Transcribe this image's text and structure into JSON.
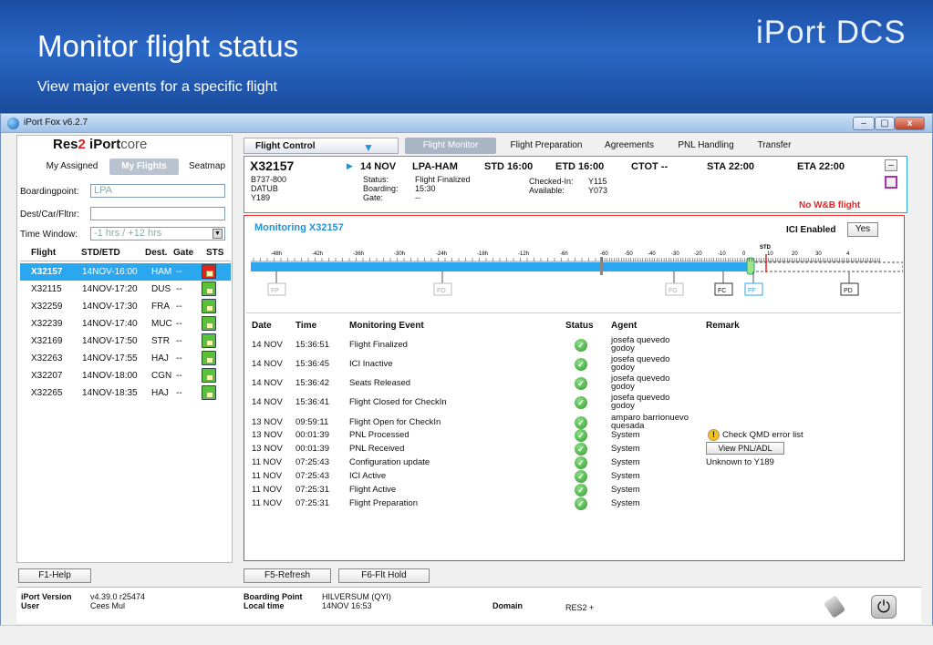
{
  "slide": {
    "title": "Monitor flight status",
    "subtitle": "View major events for a specific flight",
    "brand": "iPort DCS"
  },
  "window": {
    "title": "iPort Fox v6.2.7",
    "controls": {
      "min": "–",
      "max": "▢",
      "close": "x"
    }
  },
  "logo": {
    "part1": "Res",
    "part2": "2",
    "part3": " iPort",
    "part4": "core"
  },
  "left_tabs": [
    "My Assigned",
    "My Flights",
    "Seatmap"
  ],
  "filters": {
    "boardingpoint_label": "Boardingpoint:",
    "boardingpoint_value": "LPA",
    "destcar_label": "Dest/Car/Fltnr:",
    "destcar_value": "",
    "timewindow_label": "Time Window:",
    "timewindow_value": "-1 hrs / +12 hrs"
  },
  "flight_list": {
    "headers": {
      "flight": "Flight",
      "stdetd": "STD/ETD",
      "dest": "Dest.",
      "gate": "Gate",
      "sts": "STS"
    },
    "rows": [
      {
        "flight": "X32157",
        "time": "14NOV-16:00",
        "dest": "HAM",
        "gate": "--",
        "lock": "red"
      },
      {
        "flight": "X32115",
        "time": "14NOV-17:20",
        "dest": "DUS",
        "gate": "--",
        "lock": "green"
      },
      {
        "flight": "X32259",
        "time": "14NOV-17:30",
        "dest": "FRA",
        "gate": "--",
        "lock": "green"
      },
      {
        "flight": "X32239",
        "time": "14NOV-17:40",
        "dest": "MUC",
        "gate": "--",
        "lock": "green"
      },
      {
        "flight": "X32169",
        "time": "14NOV-17:50",
        "dest": "STR",
        "gate": "--",
        "lock": "green"
      },
      {
        "flight": "X32263",
        "time": "14NOV-17:55",
        "dest": "HAJ",
        "gate": "--",
        "lock": "green"
      },
      {
        "flight": "X32207",
        "time": "14NOV-18:00",
        "dest": "CGN",
        "gate": "--",
        "lock": "green"
      },
      {
        "flight": "X32265",
        "time": "14NOV-18:35",
        "dest": "HAJ",
        "gate": "--",
        "lock": "green"
      }
    ]
  },
  "right_tabs": [
    "Flight Control",
    "Flight Monitor",
    "Flight Preparation",
    "Agreements",
    "PNL Handling",
    "Transfer"
  ],
  "flight_header": {
    "flight": "X32157",
    "date": "14 NOV",
    "route": "LPA-HAM",
    "std": "STD 16:00",
    "etd": "ETD 16:00",
    "ctot": "CTOT  --",
    "sta": "STA 22:00",
    "eta": "ETA 22:00",
    "aircraft": "B737-800",
    "reg": "DATUB",
    "config": "Y189",
    "status_label": "Status:",
    "status_value": "Flight Finalized",
    "boarding_label": "Boarding:",
    "boarding_value": "15:30",
    "gate_label": "Gate:",
    "gate_value": "--",
    "checkedin_label": "Checked-In:",
    "checkedin_value": "Y115",
    "available_label": "Available:",
    "available_value": "Y073",
    "wb_warning": "No W&B flight",
    "collapse": "–"
  },
  "monitor": {
    "title": "Monitoring X32157",
    "ici_label": "ICI Enabled",
    "ici_value": "Yes",
    "timeline_labels": [
      "-48h",
      "-42h",
      "-36h",
      "-30h",
      "-24h",
      "-18h",
      "-12h",
      "-6h",
      "-60",
      "-50",
      "-40",
      "-30",
      "-20",
      "-10",
      "0",
      "10",
      "20",
      "30",
      "4"
    ],
    "std_marker": "STD",
    "markers": [
      "FP",
      "FO",
      "FG",
      "FC",
      "FF",
      "PD"
    ],
    "headers": {
      "date": "Date",
      "time": "Time",
      "event": "Monitoring Event",
      "status": "Status",
      "agent": "Agent",
      "remark": "Remark"
    },
    "events": [
      {
        "date": "14 NOV",
        "time": "15:36:51",
        "event": "Flight Finalized",
        "agent": "josefa quevedo",
        "agent2": "godoy",
        "remark": ""
      },
      {
        "date": "14 NOV",
        "time": "15:36:45",
        "event": "ICI Inactive",
        "agent": "josefa quevedo",
        "agent2": "godoy",
        "remark": ""
      },
      {
        "date": "14 NOV",
        "time": "15:36:42",
        "event": "Seats Released",
        "agent": "josefa quevedo",
        "agent2": "godoy",
        "remark": ""
      },
      {
        "date": "14 NOV",
        "time": "15:36:41",
        "event": "Flight Closed for CheckIn",
        "agent": "josefa quevedo",
        "agent2": "godoy",
        "remark": ""
      },
      {
        "date": "13 NOV",
        "time": "09:59:11",
        "event": "Flight Open for CheckIn",
        "agent": "amparo barrionuevo",
        "agent2": "quesada",
        "remark": ""
      },
      {
        "date": "13 NOV",
        "time": "00:01:39",
        "event": "PNL Processed",
        "agent": "System",
        "agent2": "",
        "remark": "Check QMD error list"
      },
      {
        "date": "13 NOV",
        "time": "00:01:39",
        "event": "PNL Received",
        "agent": "System",
        "agent2": "",
        "remark": "View PNL/ADL"
      },
      {
        "date": "11 NOV",
        "time": "07:25:43",
        "event": "Configuration update",
        "agent": "System",
        "agent2": "",
        "remark": "Unknown to Y189"
      },
      {
        "date": "11 NOV",
        "time": "07:25:43",
        "event": "ICI Active",
        "agent": "System",
        "agent2": "",
        "remark": ""
      },
      {
        "date": "11 NOV",
        "time": "07:25:31",
        "event": "Flight Active",
        "agent": "System",
        "agent2": "",
        "remark": ""
      },
      {
        "date": "11 NOV",
        "time": "07:25:31",
        "event": "Flight Preparation",
        "agent": "System",
        "agent2": "",
        "remark": ""
      }
    ]
  },
  "fkeys": {
    "help": "F1-Help",
    "refresh": "F5-Refresh",
    "hold": "F6-Flt Hold"
  },
  "statusbar": {
    "version_label": "iPort Version",
    "version_value": "v4.39.0 r25474",
    "user_label": "User",
    "user_value": "Cees Mul",
    "bp_label": "Boarding Point",
    "bp_value": "HILVERSUM (QYI)",
    "lt_label": "Local time",
    "lt_value": "14NOV 16:53",
    "domain_label": "Domain",
    "domain_value": "RES2  +"
  },
  "colors": {
    "selected_row": "#2aa7ee",
    "alert_red": "#e33",
    "banner": "#1c4da3"
  }
}
